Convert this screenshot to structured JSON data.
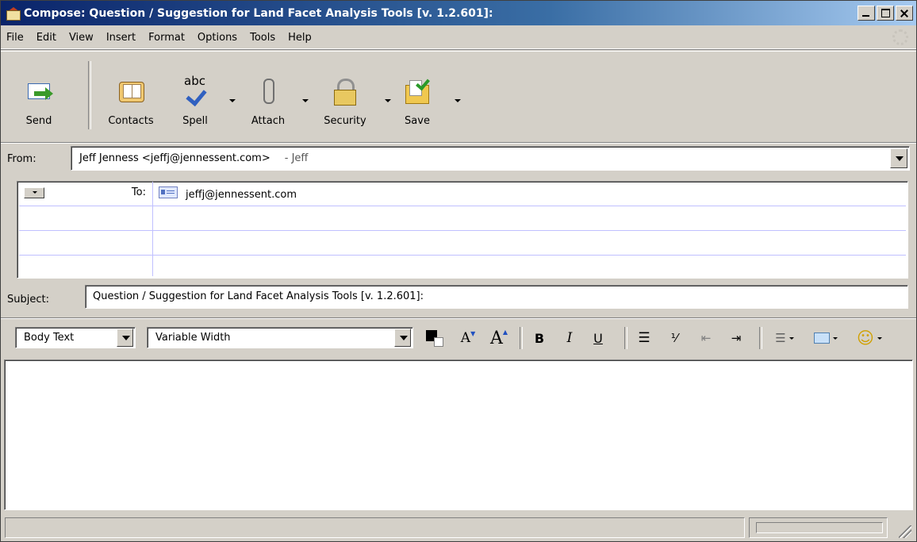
{
  "window": {
    "title": "Compose: Question / Suggestion for Land Facet Analysis Tools [v. 1.2.601]:"
  },
  "menu": {
    "items": [
      "File",
      "Edit",
      "View",
      "Insert",
      "Format",
      "Options",
      "Tools",
      "Help"
    ]
  },
  "toolbar": {
    "send": "Send",
    "contacts": "Contacts",
    "spell": "Spell",
    "spell_icon_text": "abc",
    "attach": "Attach",
    "security": "Security",
    "save": "Save"
  },
  "from": {
    "label": "From:",
    "value": "Jeff Jenness <jeffj@jennessent.com>",
    "identity": "- Jeff"
  },
  "recipients": {
    "rows": [
      {
        "type": "To:",
        "address": "jeffj@jennessent.com"
      },
      {
        "type": "",
        "address": ""
      },
      {
        "type": "",
        "address": ""
      },
      {
        "type": "",
        "address": ""
      }
    ]
  },
  "subject": {
    "label": "Subject:",
    "value": "Question / Suggestion for Land Facet Analysis Tools [v. 1.2.601]:"
  },
  "format": {
    "paragraph_style": "Body Text",
    "font": "Variable Width",
    "bold": "B",
    "italic": "I",
    "underline": "U",
    "smaller_font": "A",
    "larger_font": "A",
    "text_color": "#000000"
  }
}
